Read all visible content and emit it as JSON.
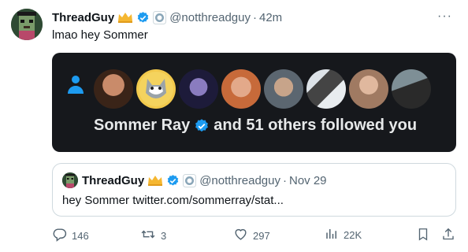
{
  "tweet": {
    "author_name": "ThreadGuy",
    "author_handle": "@notthreadguy",
    "separator": "·",
    "time": "42m",
    "text": "lmao hey Sommer",
    "more": "···"
  },
  "card": {
    "followed_name": "Sommer Ray",
    "followed_suffix": "and 51 others followed you",
    "avatar_count": 8
  },
  "quote": {
    "author_name": "ThreadGuy",
    "author_handle": "@notthreadguy",
    "separator": "·",
    "date": "Nov 29",
    "text": "hey Sommer twitter.com/sommerray/stat..."
  },
  "actions": {
    "replies": "146",
    "retweets": "3",
    "likes": "297",
    "views": "22K"
  },
  "colors": {
    "verified": "#1d9bf0",
    "card_bg": "#16181c",
    "muted": "#536471"
  }
}
